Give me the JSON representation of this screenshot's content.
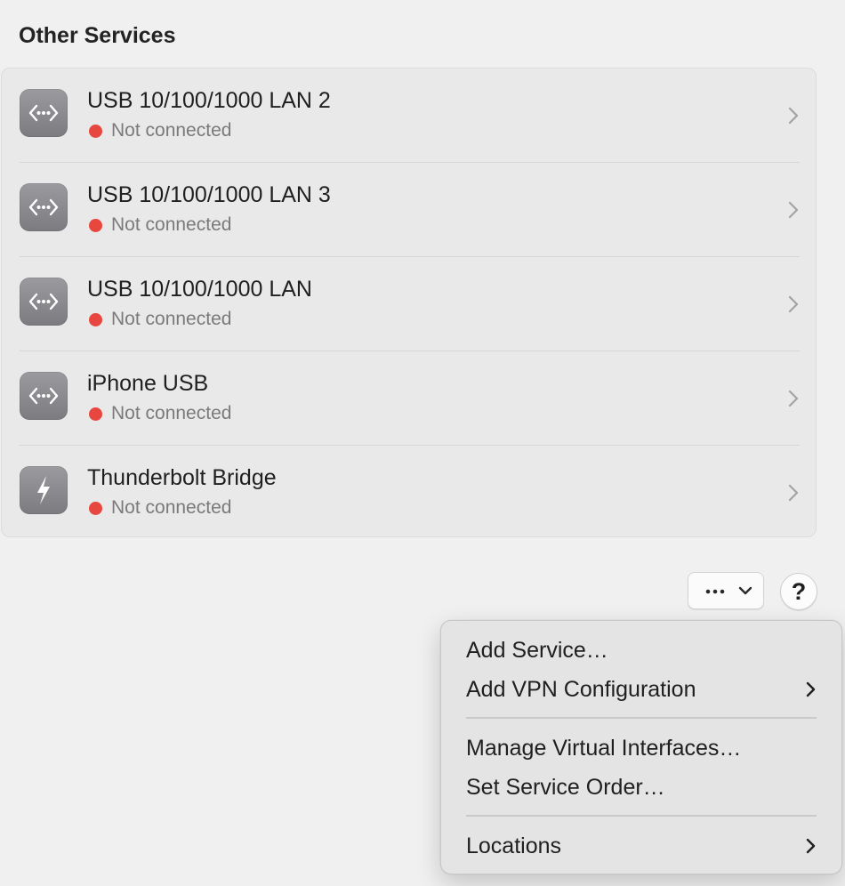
{
  "section": {
    "title": "Other Services"
  },
  "services": [
    {
      "name": "USB 10/100/1000 LAN 2",
      "status": "Not connected",
      "icon": "ethernet-dots-icon",
      "status_color": "#e8473f"
    },
    {
      "name": "USB 10/100/1000 LAN 3",
      "status": "Not connected",
      "icon": "ethernet-dots-icon",
      "status_color": "#e8473f"
    },
    {
      "name": "USB 10/100/1000 LAN",
      "status": "Not connected",
      "icon": "ethernet-dots-icon",
      "status_color": "#e8473f"
    },
    {
      "name": "iPhone USB",
      "status": "Not connected",
      "icon": "ethernet-dots-icon",
      "status_color": "#e8473f"
    },
    {
      "name": "Thunderbolt Bridge",
      "status": "Not connected",
      "icon": "thunderbolt-icon",
      "status_color": "#e8473f"
    }
  ],
  "toolbar": {
    "more_icon": "ellipsis-icon",
    "help_label": "?"
  },
  "menu": {
    "items": [
      {
        "label": "Add Service…",
        "submenu": false
      },
      {
        "label": "Add VPN Configuration",
        "submenu": true
      },
      {
        "label": "Manage Virtual Interfaces…",
        "submenu": false
      },
      {
        "label": "Set Service Order…",
        "submenu": false
      },
      {
        "label": "Locations",
        "submenu": true
      }
    ]
  }
}
